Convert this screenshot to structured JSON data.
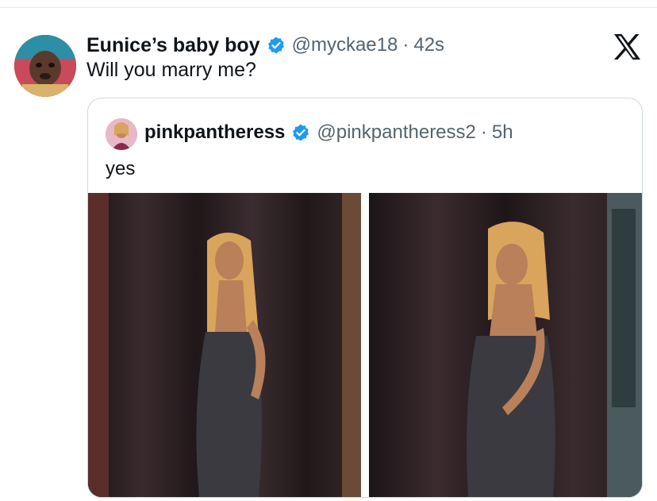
{
  "tweet": {
    "author": {
      "display_name": "Eunice’s baby boy",
      "handle": "@myckae18",
      "time": "42s",
      "verified": true
    },
    "text": "Will you marry me?",
    "separator": "·"
  },
  "quoted": {
    "author": {
      "display_name": "pinkpantheress",
      "handle": "@pinkpantheress2",
      "time": "5h",
      "verified": true
    },
    "text": "yes",
    "separator": "·",
    "media": [
      {
        "description_icon": "photo-1"
      },
      {
        "description_icon": "photo-2"
      }
    ]
  },
  "brand": {
    "logo": "x-logo-icon",
    "verified_color": "#1d9bf0",
    "text_color": "#0f1419",
    "muted_color": "#536471"
  }
}
